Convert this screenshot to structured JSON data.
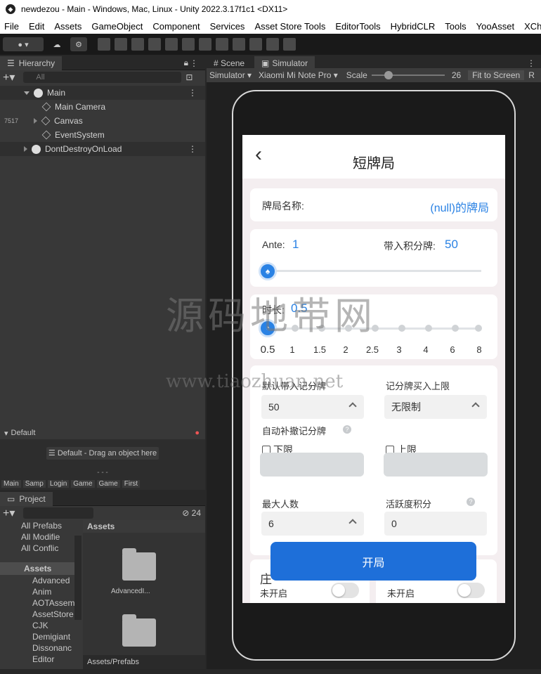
{
  "window": {
    "title": "newdezou - Main - Windows, Mac, Linux - Unity 2022.3.17f1c1 <DX11>"
  },
  "menu": [
    "File",
    "Edit",
    "Assets",
    "GameObject",
    "Component",
    "Services",
    "Asset Store Tools",
    "EditorTools",
    "HybridCLR",
    "Tools",
    "YooAsset",
    "XCha"
  ],
  "hierarchy": {
    "tab": "Hierarchy",
    "search_placeholder": "All",
    "side_number": "7517",
    "items": [
      {
        "label": "Main"
      },
      {
        "label": "Main Camera"
      },
      {
        "label": "Canvas"
      },
      {
        "label": "EventSystem"
      },
      {
        "label": "DontDestroyOnLoad"
      }
    ]
  },
  "default_panel": {
    "title": "Default",
    "hint": "☰ Default - Drag an object here",
    "dashes": "- - -",
    "tabs": [
      "Main",
      "Samp",
      "Login",
      "Game",
      "Game",
      "First"
    ]
  },
  "project": {
    "tab": "Project",
    "count": "24",
    "favorites": [
      "All Prefabs",
      "All Modifie",
      "All Conflic"
    ],
    "assets_label": "Assets",
    "folders": [
      "Advanced",
      "Anim",
      "AOTAssem",
      "AssetStore",
      "CJK",
      "Demigiant",
      "Dissonanc",
      "Editor"
    ],
    "grid_header": "Assets",
    "grid_items": [
      "AdvancedI..."
    ],
    "path": "Assets/Prefabs"
  },
  "scene": {
    "tabs": [
      "Scene",
      "Simulator"
    ],
    "simulator_label": "Simulator",
    "device": "Xiaomi Mi Note Pro",
    "scale_label": "Scale",
    "scale_value": "26",
    "fit_label": "Fit to Screen",
    "r_label": "R"
  },
  "app": {
    "title": "短牌局",
    "back": "‹",
    "name_label": "牌局名称:",
    "name_value": "(null)的牌局",
    "ante_label": "Ante:",
    "ante_value": "1",
    "buyin_label": "带入积分牌:",
    "buyin_value": "50",
    "duration_label": "时长:",
    "duration_value": "0.5",
    "duration_ticks": [
      "0.5",
      "1",
      "1.5",
      "2",
      "2.5",
      "3",
      "4",
      "6",
      "8"
    ],
    "default_buyin_label": "默认带入记分牌",
    "default_buyin_value": "50",
    "buy_limit_label": "记分牌买入上限",
    "buy_limit_value": "无限制",
    "auto_label": "自动补撤记分牌",
    "lower_label": "下限",
    "upper_label": "上限",
    "max_players_label": "最大人数",
    "max_players_value": "6",
    "activity_label": "活跃度积分",
    "activity_value": "0",
    "open_button": "开局",
    "left_card_title": "庄",
    "off1": "未开启",
    "off2": "未开启"
  },
  "watermark": {
    "line1": "源码地带网",
    "line2": "www.tiaozhuan.net"
  },
  "colors": {
    "accent": "#1e6fd9",
    "blue_text": "#2a82e4",
    "unity_bg": "#383838"
  }
}
